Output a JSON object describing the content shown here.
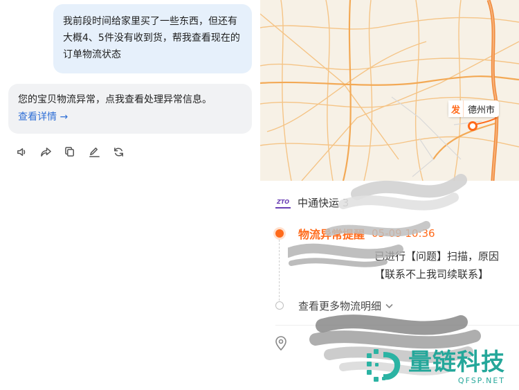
{
  "chat": {
    "user_message": "我前段时间给家里买了一些东西，但还有大概4、5件没有收到货，帮我查看现在的订单物流状态",
    "bot_message": "您的宝贝物流异常，点我查看处理异常信息。",
    "bot_link": "查看详情 →",
    "actions": [
      {
        "name": "speaker-icon"
      },
      {
        "name": "share-icon"
      },
      {
        "name": "copy-icon"
      },
      {
        "name": "edit-icon"
      },
      {
        "name": "regenerate-icon"
      }
    ]
  },
  "map": {
    "origin_tag": "发",
    "city": "德州市",
    "road_color": "#f5b96a",
    "highway_color": "#f08a3c"
  },
  "logistics": {
    "carrier": "中通快运",
    "carrier_suffix": "3",
    "status_title": "物流异常提醒",
    "status_time": "05-09 10:36",
    "detail_line1": "已进行【问题】扫描，原因",
    "detail_line2": "【联系不上我司续联系】",
    "more_label": "查看更多物流明细",
    "accent_color": "#ff6a1a"
  },
  "watermark": {
    "title": "量链科技",
    "subtitle": "QFSP.NET"
  }
}
